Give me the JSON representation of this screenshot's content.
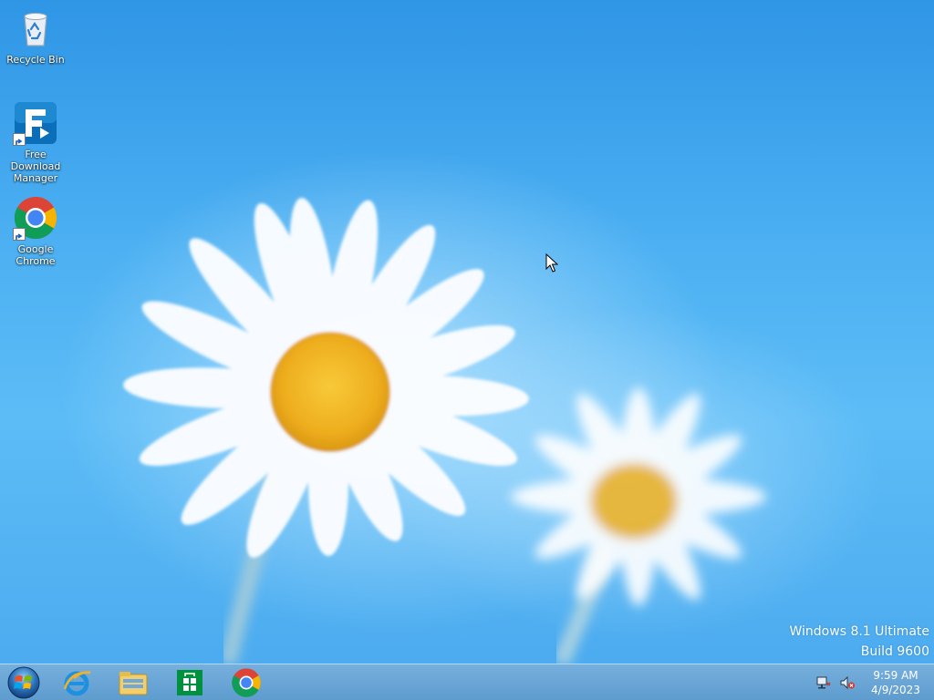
{
  "desktop": {
    "icons": [
      {
        "label": "Recycle Bin",
        "icon": "recycle-bin-icon"
      },
      {
        "label": "Free Download\nManager",
        "icon": "fdm-icon"
      },
      {
        "label": "Google Chrome",
        "icon": "chrome-icon"
      }
    ],
    "watermark": {
      "line1": "Windows 8.1 Ultimate",
      "line2": "Build 9600"
    }
  },
  "taskbar": {
    "start": {
      "icon": "windows-orb-icon"
    },
    "pinned": [
      {
        "icon": "internet-explorer-icon"
      },
      {
        "icon": "file-explorer-icon"
      },
      {
        "icon": "windows-store-icon"
      },
      {
        "icon": "chrome-icon"
      }
    ],
    "tray": {
      "icons": [
        "network-icon",
        "volume-muted-icon"
      ],
      "time": "9:59 AM",
      "date": "4/9/2023"
    }
  },
  "colors": {
    "sky_top": "#2f96e6",
    "sky_mid": "#5cbcf6",
    "taskbar": "#6fa6d6",
    "daisy_center": "#f2b724"
  }
}
